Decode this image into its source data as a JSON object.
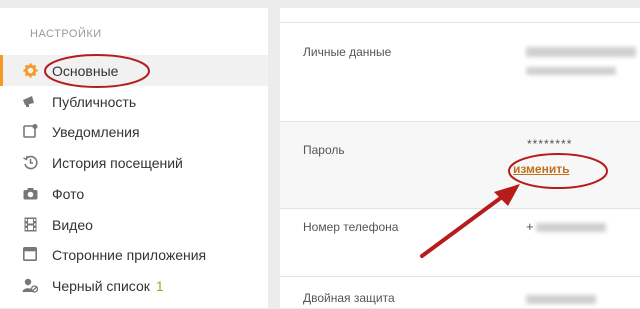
{
  "sidebar": {
    "heading": "НАСТРОЙКИ",
    "items": [
      {
        "label": "Основные",
        "icon": "gear-icon",
        "active": true
      },
      {
        "label": "Публичность",
        "icon": "megaphone-icon"
      },
      {
        "label": "Уведомления",
        "icon": "notification-icon"
      },
      {
        "label": "История посещений",
        "icon": "history-icon"
      },
      {
        "label": "Фото",
        "icon": "camera-icon"
      },
      {
        "label": "Видео",
        "icon": "film-icon"
      },
      {
        "label": "Сторонние приложения",
        "icon": "apps-icon"
      },
      {
        "label": "Черный список",
        "icon": "user-block-icon",
        "count": "1"
      }
    ]
  },
  "settings": {
    "personal_label": "Личные данные",
    "password_label": "Пароль",
    "password_value": "********",
    "change_link": "изменить",
    "phone_label": "Номер телефона",
    "phone_prefix": "+",
    "twofa_label": "Двойная защита"
  },
  "colors": {
    "accent": "#f59a23",
    "link": "#c0701a",
    "count": "#7bb43a",
    "annotation": "#b71c1c"
  }
}
